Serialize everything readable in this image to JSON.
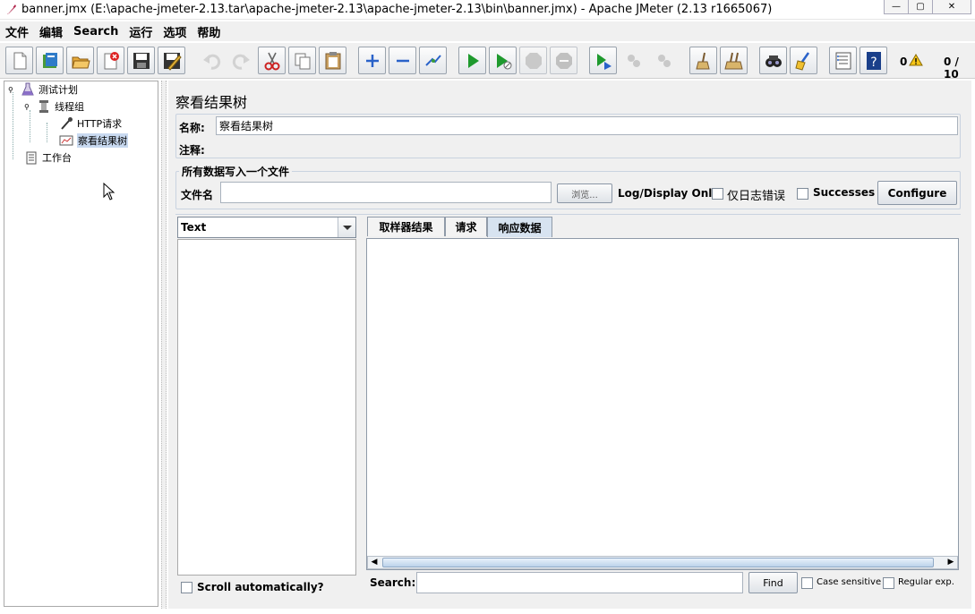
{
  "window": {
    "title": "banner.jmx (E:\\apache-jmeter-2.13.tar\\apache-jmeter-2.13\\apache-jmeter-2.13\\bin\\banner.jmx) - Apache JMeter (2.13 r1665067)"
  },
  "menu": [
    "文件",
    "编辑",
    "Search",
    "运行",
    "选项",
    "帮助"
  ],
  "toolbar": {
    "buttons": [
      "new-icon",
      "templates-icon",
      "open-icon",
      "close-icon",
      "save-icon",
      "save-as-icon",
      "undo-icon",
      "redo-icon",
      "cut-icon",
      "copy-icon",
      "paste-icon",
      "expand-icon",
      "collapse-icon",
      "toggle-icon",
      "start-icon",
      "start-no-pause-icon",
      "stop-icon",
      "shutdown-icon",
      "remote-start-icon",
      "remote-stop-icon",
      "remote-shutdown-icon",
      "clear-icon",
      "clear-all-icon",
      "search-icon",
      "reset-search-icon",
      "function-helper-icon",
      "help-icon"
    ],
    "warning_count": "0",
    "thread_count": "0 / 10"
  },
  "tree": {
    "test_plan": "测试计划",
    "thread_group": "线程组",
    "http_request": "HTTP请求",
    "result_tree": "察看结果树",
    "workbench": "工作台"
  },
  "panel": {
    "title": "察看结果树",
    "name_label": "名称:",
    "name_value": "察看结果树",
    "comment_label": "注释:",
    "file_group_title": "所有数据写入一个文件",
    "filename_label": "文件名",
    "browse_label": "浏览...",
    "log_display_label": "Log/Display Only:",
    "errors_label": "仅日志错误",
    "successes_label": "Successes",
    "configure_label": "Configure",
    "renderer_selected": "Text",
    "scroll_auto_label": "Scroll automatically?",
    "tabs": [
      "取样器结果",
      "请求",
      "响应数据"
    ],
    "active_tab": "响应数据",
    "search_label": "Search:",
    "find_label": "Find",
    "case_sensitive_label": "Case sensitive",
    "regex_label": "Regular exp."
  },
  "colors": {
    "accent": "#c8d9f0",
    "tab_active": "#d7e3f0",
    "start_green": "#1f9a2e",
    "cut_red": "#cc2222"
  }
}
